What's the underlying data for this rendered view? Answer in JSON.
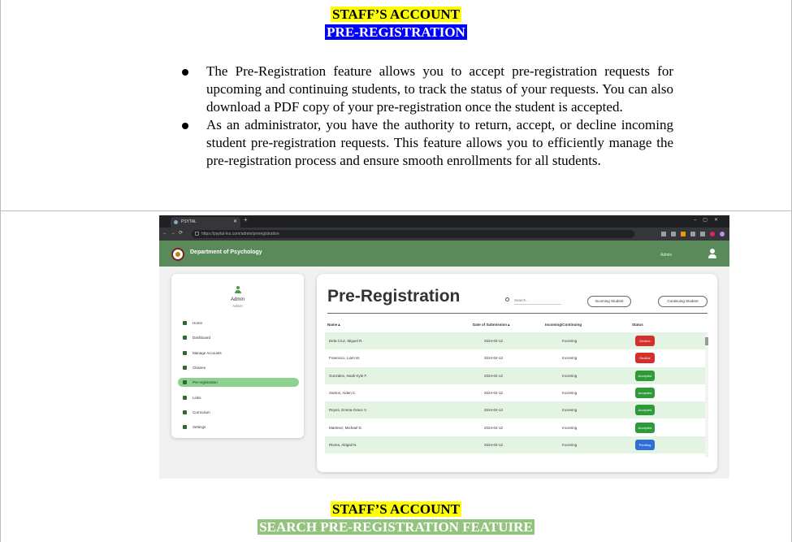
{
  "doc": {
    "heading1_line1": "STAFF’S ACCOUNT",
    "heading1_line2": "PRE-REGISTRATION",
    "bullets": [
      "The Pre-Registration feature allows you to accept pre-registration requests for upcoming and continuing students, to track the status of your requests. You can also download a PDF copy of your pre-registration once the student is accepted.",
      "As an administrator, you have the authority to return, accept, or decline incoming student pre-registration requests. This feature allows you to efficiently manage the pre-registration process and ensure smooth enrollments for all students."
    ],
    "heading2_line1": "STAFF’S ACCOUNT",
    "heading2_line2": "SEARCH PRE-REGISTRATION FEATUIRE"
  },
  "browser": {
    "tab_title": "PSYTAL",
    "url": "https://psytal-lnu.com/admin/preregistration"
  },
  "app": {
    "department": "Department of Psychology",
    "header_user": "Admin",
    "sidebar": {
      "name": "Admin",
      "role": "Admin",
      "items": [
        {
          "label": "Home",
          "icon": "home-icon"
        },
        {
          "label": "Dashboard",
          "icon": "dashboard-icon"
        },
        {
          "label": "Manage Accounts",
          "icon": "users-icon"
        },
        {
          "label": "Classes",
          "icon": "classes-icon"
        },
        {
          "label": "Pre-registration",
          "icon": "document-icon",
          "active": true
        },
        {
          "label": "Links",
          "icon": "link-icon"
        },
        {
          "label": "Curriculum",
          "icon": "graduation-cap-icon"
        },
        {
          "label": "Settings",
          "icon": "gear-icon"
        }
      ]
    },
    "main": {
      "title": "Pre-Registration",
      "search_placeholder": "Search...",
      "btn_incoming": "Incoming Student",
      "btn_continuing": "Continuing Student",
      "columns": [
        "Name▲",
        "Date of Submission▲",
        "Incoming/Continuing",
        "Status"
      ],
      "rows": [
        {
          "name": "Dela Cruz, Miguel R.",
          "date": "2024-02-12",
          "type": "Incoming",
          "status": "Decline"
        },
        {
          "name": "Francisco, Liam M.",
          "date": "2024-02-12",
          "type": "Incoming",
          "status": "Decline"
        },
        {
          "name": "Gonzales, Noah Kyle F.",
          "date": "2024-02-12",
          "type": "Incoming",
          "status": "Accepted"
        },
        {
          "name": "Santos, Aiden C.",
          "date": "2024-02-12",
          "type": "Incoming",
          "status": "Accepted"
        },
        {
          "name": "Reyes, Emma Grace V.",
          "date": "2024-02-12",
          "type": "Incoming",
          "status": "Accepted"
        },
        {
          "name": "Martinez, Michael D.",
          "date": "2024-02-12",
          "type": "Incoming",
          "status": "Accepted"
        },
        {
          "name": "Rivera, Abigail N.",
          "date": "2024-02-12",
          "type": "Incoming",
          "status": "Pending"
        }
      ]
    }
  },
  "colors": {
    "header_green": "#5a8a5a",
    "active_green": "#8fd18f",
    "row_alt": "#e3f4e3",
    "decline": "#d32f2f",
    "accepted": "#2e9a3a",
    "pending": "#2f6fd6"
  }
}
